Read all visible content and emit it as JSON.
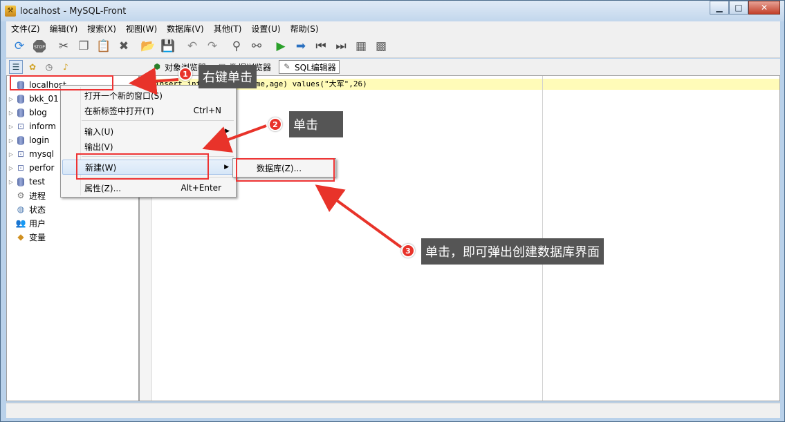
{
  "window": {
    "title": "localhost - MySQL-Front",
    "controls": {
      "minimize": "▁",
      "maximize": "□",
      "close": "✕"
    }
  },
  "menubar": {
    "items": [
      "文件(Z)",
      "编辑(Y)",
      "搜索(X)",
      "视图(W)",
      "数据库(V)",
      "其他(T)",
      "设置(U)",
      "帮助(S)"
    ]
  },
  "toolbar": {
    "icons": [
      "refresh-icon",
      "stop-icon",
      "cut-icon",
      "copy-icon",
      "paste-icon",
      "delete-icon",
      "open-icon",
      "save-icon",
      "undo-icon",
      "redo-icon",
      "find-icon",
      "replace-icon",
      "run-icon",
      "run-selection-icon",
      "first-record-icon",
      "last-record-icon",
      "grid-insert-icon",
      "grid-delete-icon"
    ]
  },
  "view_tabs": [
    {
      "label": "对象浏览器",
      "active": false
    },
    {
      "label": "数据浏览器",
      "active": false
    },
    {
      "label": "SQL编辑器",
      "active": true
    }
  ],
  "tree": {
    "items": [
      {
        "label": "localhost",
        "expandable": false,
        "icon": "server-icon"
      },
      {
        "label": "bkk_01",
        "expandable": true,
        "icon": "database-icon"
      },
      {
        "label": "blog",
        "expandable": true,
        "icon": "database-icon"
      },
      {
        "label": "inform",
        "expandable": true,
        "icon": "system-database-icon"
      },
      {
        "label": "login",
        "expandable": true,
        "icon": "database-icon"
      },
      {
        "label": "mysql",
        "expandable": true,
        "icon": "system-database-icon"
      },
      {
        "label": "perfor",
        "expandable": true,
        "icon": "system-database-icon"
      },
      {
        "label": "test",
        "expandable": true,
        "icon": "database-icon"
      },
      {
        "label": "进程",
        "expandable": false,
        "icon": "process-icon"
      },
      {
        "label": "状态",
        "expandable": false,
        "icon": "status-icon"
      },
      {
        "label": "用户",
        "expandable": false,
        "icon": "users-icon"
      },
      {
        "label": "变量",
        "expandable": false,
        "icon": "variables-icon"
      }
    ]
  },
  "editor": {
    "line_number": "1",
    "code": "insert into history(name,age) values(\"大军\",26)"
  },
  "context_menu": {
    "items": [
      {
        "label": "打开一个新的窗口(S)",
        "shortcut": ""
      },
      {
        "label": "在新标签中打开(T)",
        "shortcut": "Ctrl+N"
      },
      {
        "label": "输入(U)",
        "shortcut": "",
        "submenu": true
      },
      {
        "label": "输出(V)",
        "shortcut": "",
        "submenu": true
      },
      {
        "label": "新建(W)",
        "shortcut": "",
        "submenu": true
      },
      {
        "label": "属性(Z)...",
        "shortcut": "Alt+Enter"
      }
    ]
  },
  "submenu": {
    "items": [
      {
        "label": "数据库(Z)..."
      }
    ]
  },
  "annotations": {
    "callouts": [
      {
        "number": "1",
        "text": "右键单击"
      },
      {
        "number": "2",
        "text": "单击"
      },
      {
        "number": "3",
        "text": "单击，即可弹出创建数据库界面"
      }
    ],
    "color": "#e8332a"
  }
}
